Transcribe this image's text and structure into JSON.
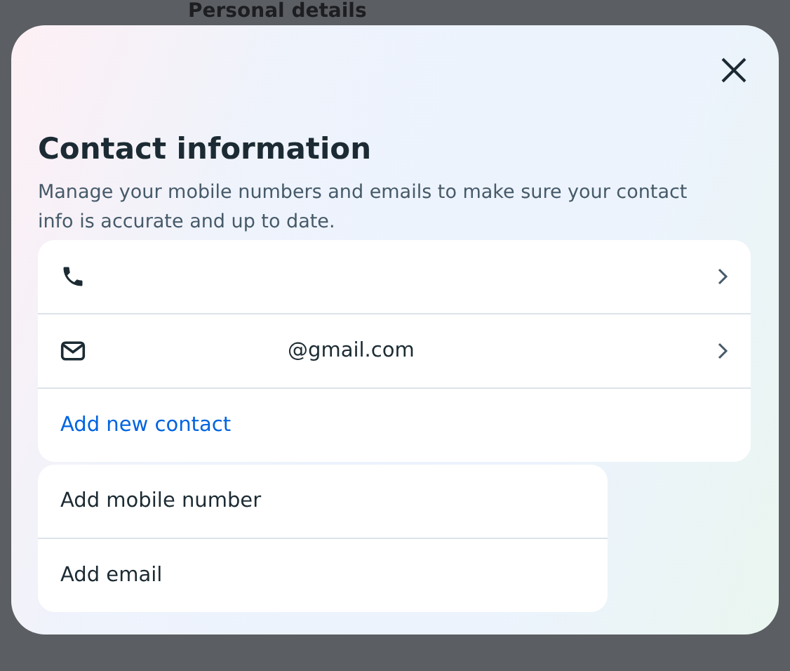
{
  "background": {
    "heading": "Personal details"
  },
  "dialog": {
    "title": "Contact information",
    "description": "Manage your mobile numbers and emails to make sure your contact info is accurate and up to date.",
    "contacts": [
      {
        "kind": "phone"
      },
      {
        "kind": "email",
        "value": "@gmail.com"
      }
    ],
    "add_link": "Add new contact",
    "menu": [
      "Add mobile number",
      "Add email"
    ]
  }
}
